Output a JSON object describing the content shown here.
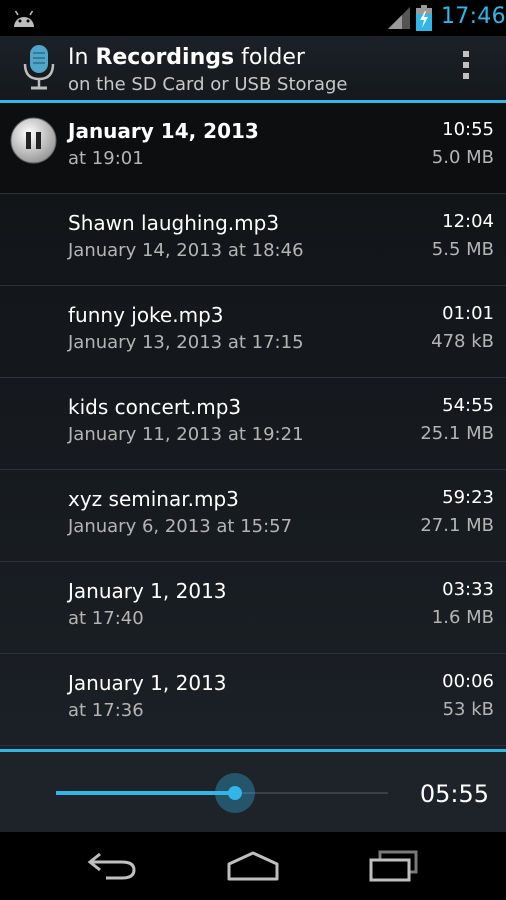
{
  "status_bar": {
    "time": "17:46",
    "icons": [
      "android-icon",
      "signal-icon",
      "battery-charging-icon"
    ],
    "accent_color": "#33b5e5"
  },
  "action_bar": {
    "title_prefix": "In ",
    "title_bold": "Recordings",
    "title_suffix": " folder",
    "subtitle": "on the SD Card or USB Storage",
    "icons": [
      "microphone-icon",
      "overflow-menu-icon"
    ]
  },
  "recordings": [
    {
      "line1": "January 14, 2013",
      "line2": "at 19:01",
      "duration": "10:55",
      "size": "5.0 MB",
      "playing": true
    },
    {
      "line1": "Shawn laughing.mp3",
      "line2": "January 14, 2013 at 18:46",
      "duration": "12:04",
      "size": "5.5 MB",
      "playing": false
    },
    {
      "line1": "funny joke.mp3",
      "line2": "January 13, 2013 at 17:15",
      "duration": "01:01",
      "size": "478 kB",
      "playing": false
    },
    {
      "line1": "kids concert.mp3",
      "line2": "January 11, 2013 at 19:21",
      "duration": "54:55",
      "size": "25.1 MB",
      "playing": false
    },
    {
      "line1": "xyz seminar.mp3",
      "line2": "January 6, 2013 at 15:57",
      "duration": "59:23",
      "size": "27.1 MB",
      "playing": false
    },
    {
      "line1": "January 1, 2013",
      "line2": "at 17:40",
      "duration": "03:33",
      "size": "1.6 MB",
      "playing": false
    },
    {
      "line1": "January 1, 2013",
      "line2": "at 17:36",
      "duration": "00:06",
      "size": "53 kB",
      "playing": false
    }
  ],
  "player": {
    "position_fraction": 0.54,
    "time": "05:55"
  },
  "nav_bar": {
    "icons": [
      "back-icon",
      "home-icon",
      "recent-apps-icon"
    ]
  }
}
